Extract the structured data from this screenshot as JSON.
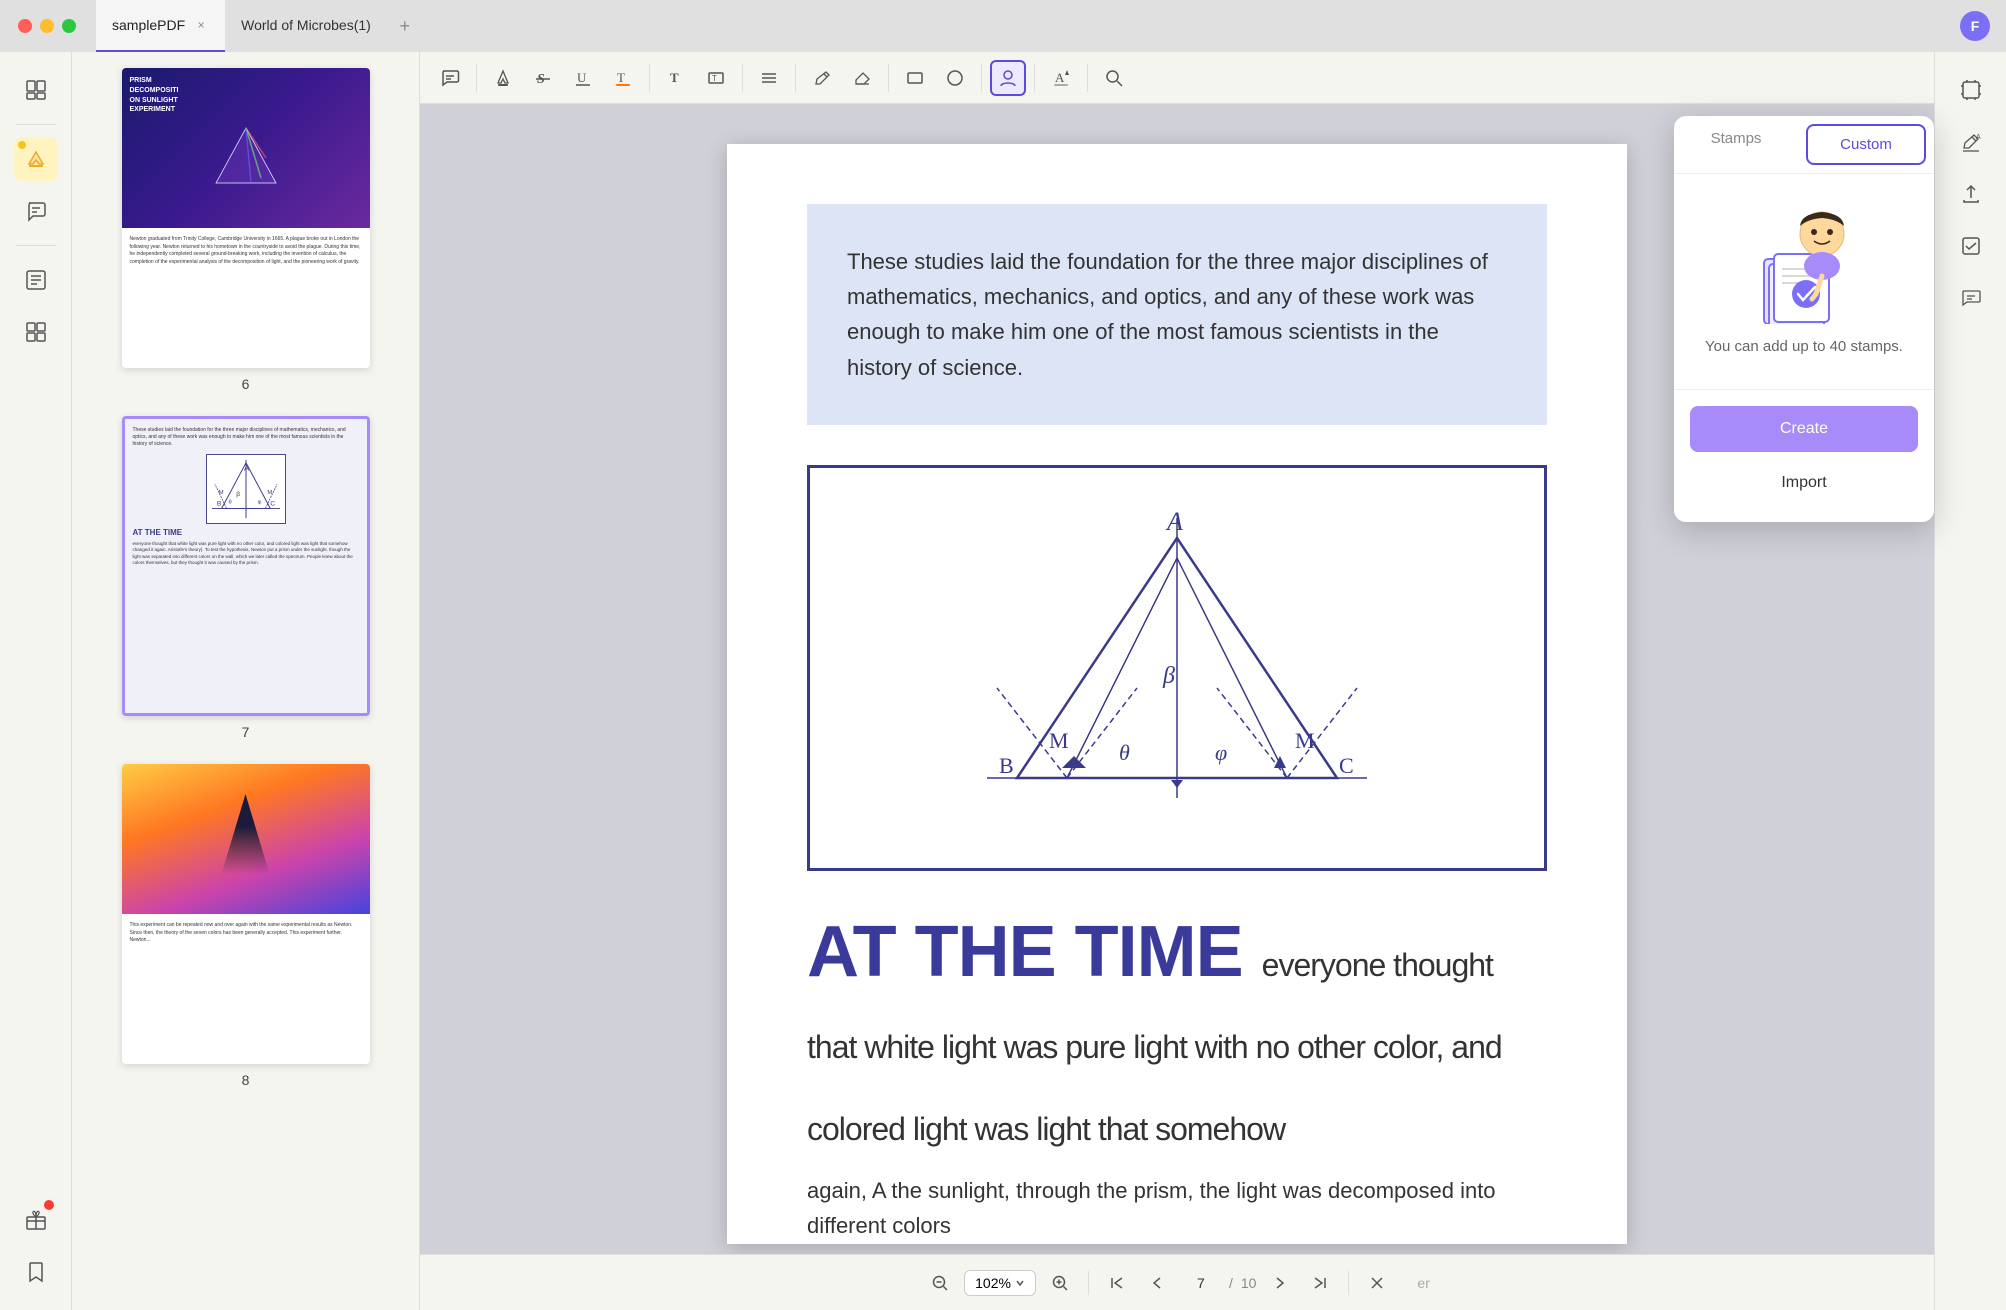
{
  "window": {
    "title": "samplePDF",
    "tab1": "samplePDF",
    "tab2": "World of Microbes(1)",
    "user_initial": "F"
  },
  "sidebar_left": {
    "icons": [
      {
        "name": "pages-icon",
        "symbol": "☰",
        "active": false
      },
      {
        "name": "highlight-icon",
        "symbol": "✏️",
        "active": true
      },
      {
        "name": "comment-icon",
        "symbol": "✍",
        "active": false
      },
      {
        "name": "stamp-icon",
        "symbol": "⬜",
        "active": false
      },
      {
        "name": "layers-icon",
        "symbol": "⧉",
        "active": false
      },
      {
        "name": "bookmark-icon",
        "symbol": "🔖",
        "active": false
      },
      {
        "name": "gift-icon",
        "symbol": "🎁",
        "active": false
      }
    ]
  },
  "toolbar": {
    "comment_btn": "💬",
    "highlight_btn": "✏",
    "strikethrough_btn": "S̶",
    "underline_btn": "U̲",
    "text_color_btn": "T",
    "text_bg_btn": "T",
    "list_btn": "☰",
    "pencil_btn": "✏",
    "eraser_btn": "⌫",
    "shape_btn": "□",
    "circle_btn": "○",
    "stamp_user_btn": "👤",
    "color_btn": "A",
    "search_btn": "🔍"
  },
  "stamps_panel": {
    "tab_stamps": "Stamps",
    "tab_custom": "Custom",
    "illustration_alt": "character with checkmark",
    "body_text": "You can add up to 40 stamps.",
    "btn_create": "Create",
    "btn_import": "Import"
  },
  "pdf_content": {
    "page6_text": "PRISM DECOMPOSITION ON SUNLIGHT EXPERIMENT",
    "intro_text": "These studies laid the foundation for the three major disciplines of mathematics, mechanics, and optics, and any of these work was enough to make him one of the most famous scientists in the history of science.",
    "heading": "AT THE TIME",
    "heading_inline": "everyone thought that white light was pure light with no other color, and colored light was light that somehow again, A the sunlight, through the prism, the light was decomposed into different colors",
    "page_num_current": "7",
    "page_num_total": "10",
    "zoom_level": "102%"
  },
  "bottom_toolbar": {
    "zoom_in": "+",
    "zoom_out": "-",
    "zoom_value": "102%",
    "page_current": "7",
    "page_separator": "/",
    "page_total": "10",
    "trailing_text": "er"
  },
  "right_sidebar": {
    "icons": [
      {
        "name": "right-icon-1",
        "symbol": "⬜"
      },
      {
        "name": "right-icon-2",
        "symbol": "✏"
      },
      {
        "name": "right-icon-3",
        "symbol": "↑"
      },
      {
        "name": "right-icon-4",
        "symbol": "✓"
      }
    ]
  },
  "thumbnails": [
    {
      "page_num": "6",
      "selected": false
    },
    {
      "page_num": "7",
      "selected": true
    },
    {
      "page_num": "8",
      "selected": false
    }
  ]
}
